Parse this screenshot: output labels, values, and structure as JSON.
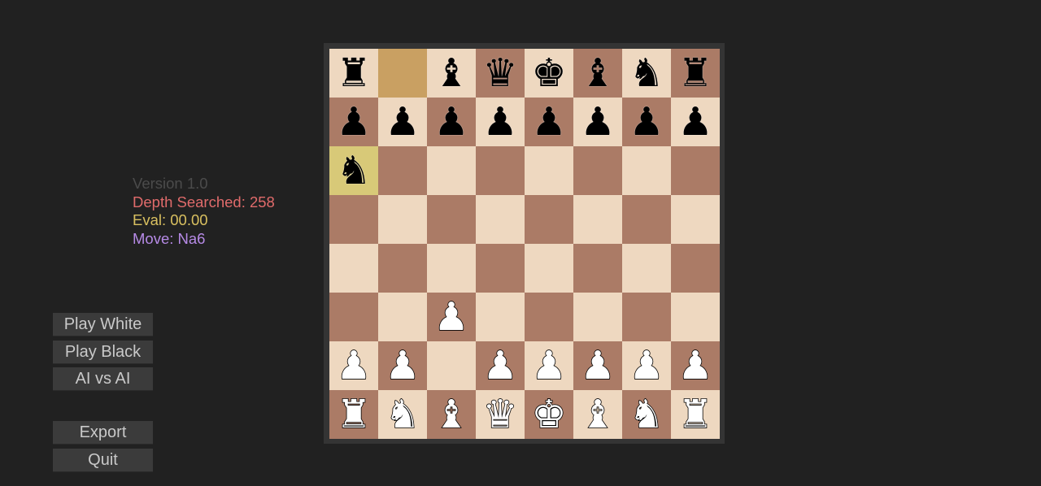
{
  "info": {
    "version": "Version 1.0",
    "depth": "Depth Searched: 258",
    "eval": "Eval: 00.00",
    "move": "Move: Na6"
  },
  "buttons": {
    "play_white": "Play White",
    "play_black": "Play Black",
    "ai_vs_ai": "AI vs AI",
    "export": "Export",
    "quit": "Quit"
  },
  "colors": {
    "light_square": "#eed8c0",
    "dark_square": "#ab7b66",
    "last_move_from": "#c9a062",
    "last_move_to": "#d8c978"
  },
  "board": {
    "last_move": {
      "from": "b8",
      "to": "a6"
    },
    "ranks": [
      [
        "br",
        "",
        "bb",
        "bq",
        "bk",
        "bb",
        "bn",
        "br"
      ],
      [
        "bp",
        "bp",
        "bp",
        "bp",
        "bp",
        "bp",
        "bp",
        "bp"
      ],
      [
        "bn",
        "",
        "",
        "",
        "",
        "",
        "",
        ""
      ],
      [
        "",
        "",
        "",
        "",
        "",
        "",
        "",
        ""
      ],
      [
        "",
        "",
        "",
        "",
        "",
        "",
        "",
        ""
      ],
      [
        "",
        "",
        "wp",
        "",
        "",
        "",
        "",
        ""
      ],
      [
        "wp",
        "wp",
        "",
        "wp",
        "wp",
        "wp",
        "wp",
        "wp"
      ],
      [
        "wr",
        "wn",
        "wb",
        "wq",
        "wk",
        "wb",
        "wn",
        "wr"
      ]
    ]
  },
  "piece_glyphs": {
    "k": "♚",
    "q": "♛",
    "r": "♜",
    "b": "♝",
    "n": "♞",
    "p": "♟"
  },
  "piece_names": {
    "k": "king",
    "q": "queen",
    "r": "rook",
    "b": "bishop",
    "n": "knight",
    "p": "pawn"
  }
}
